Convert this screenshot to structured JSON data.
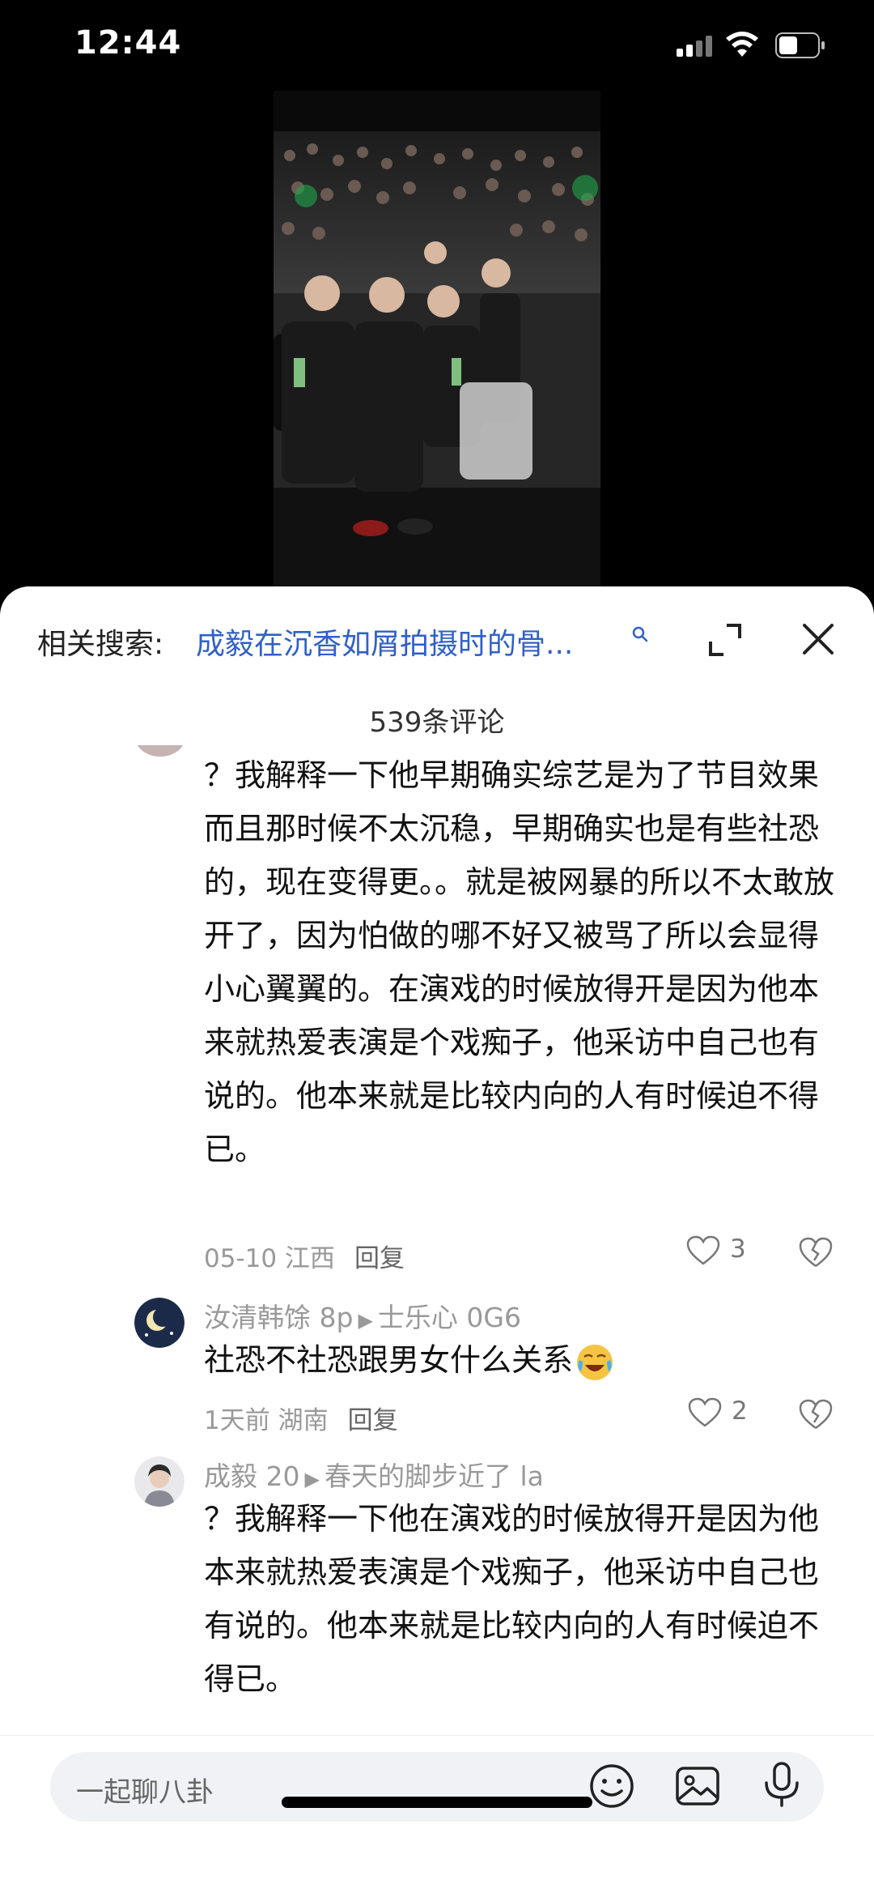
{
  "status": {
    "time": "12:44"
  },
  "sheet": {
    "related_label": "相关搜索:",
    "related_query": "成毅在沉香如屑拍摄时的骨...",
    "comment_count": "539条评论"
  },
  "comments": [
    {
      "text": "？我解释一下他早期确实综艺是为了节目效果而且那时候不太沉稳，早期确实也是有些社恐的，现在变得更。。就是被网暴的所以不太敢放开了，因为怕做的哪不好又被骂了所以会显得小心翼翼的。在演戏的时候放得开是因为他本来就热爱表演是个戏痴子，他采访中自己也有说的。他本来就是比较内向的人有时候迫不得已。",
      "date": "05-10 江西",
      "reply": "回复",
      "likes": "3"
    },
    {
      "author": "汝清韩馀 8p",
      "reply_to": "士乐心 0G6",
      "text": "社恐不社恐跟男女什么关系",
      "date": "1天前 湖南",
      "reply": "回复",
      "likes": "2"
    },
    {
      "author": "成毅 20",
      "reply_to": "春天的脚步近了 la",
      "text": "？我解释一下他在演戏的时候放得开是因为他本来就热爱表演是个戏痴子，他采访中自己也有说的。他本来就是比较内向的人有时候迫不得已。"
    }
  ],
  "input": {
    "placeholder": "一起聊八卦"
  }
}
